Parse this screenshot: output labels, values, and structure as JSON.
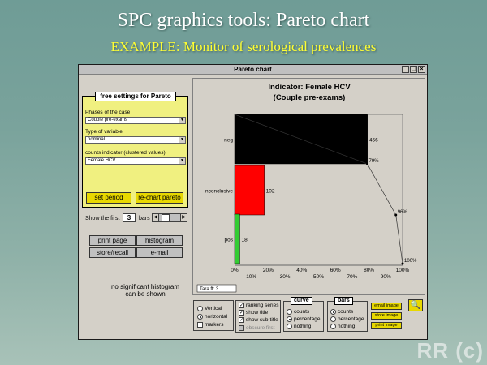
{
  "slide": {
    "title": "SPC graphics tools: Pareto chart",
    "subtitle": "EXAMPLE: Monitor of serological prevalences",
    "watermark": "RR (c)"
  },
  "window": {
    "title": "Pareto chart",
    "buttons": [
      "_",
      "□",
      "×"
    ]
  },
  "settings": {
    "header": "free settings for Pareto",
    "phases_label": "Phases of the case",
    "phases_value": "Couple pre-exams",
    "type_label": "Type of variable",
    "type_value": "nominal",
    "counts_label": "counts indicator (clustered values)",
    "counts_value": "Female HCV",
    "set_period": "set period",
    "rechart": "re-chart pareto"
  },
  "show_first": {
    "label": "Show the first",
    "value": "3",
    "suffix": "bars"
  },
  "buttons": {
    "print_page": "print page",
    "histogram": "histogram",
    "store_recall": "store/recall",
    "email": "e-mail"
  },
  "no_histogram": "no significant histogram can be shown",
  "chart_data": {
    "type": "bar",
    "orientation": "horizontal",
    "title": "Indicator: Female HCV",
    "subtitle": "(Couple pre-exams)",
    "categories": [
      "neg",
      "inconclusive",
      "pos"
    ],
    "values": [
      456,
      102,
      18
    ],
    "colors": [
      "#000000",
      "#ff0000",
      "#33cc33"
    ],
    "cumulative_labels": [
      "79%",
      "96%",
      "100%"
    ],
    "cumulative": [
      79,
      96,
      100
    ],
    "x_ticks_top": [
      "0%",
      "20%",
      "40%",
      "60%",
      "80%",
      "100%"
    ],
    "x_ticks_bottom": [
      "10%",
      "30%",
      "50%",
      "70%",
      "90%"
    ],
    "xlim": [
      0,
      100
    ],
    "total_label": "Tara ff: 3"
  },
  "orientation_group": {
    "vertical": "Vertical",
    "horizontal": "horizontal",
    "markers": "markers"
  },
  "series_group": {
    "ranking": "ranking series",
    "show_title": "show title",
    "show_subtitle": "show sub-title",
    "obscure_first": "obscure first"
  },
  "curve_group": {
    "title": "curve",
    "counts": "counts",
    "percentage": "percentage",
    "nothing": "nothing"
  },
  "bars_group": {
    "title": "bars",
    "counts": "counts",
    "percentage": "percentage",
    "nothing": "nothing"
  },
  "image_buttons": {
    "email_image": "email image",
    "store_image": "store image",
    "print_image": "print image"
  },
  "icons": {
    "magnifier": "magnifier-icon"
  }
}
